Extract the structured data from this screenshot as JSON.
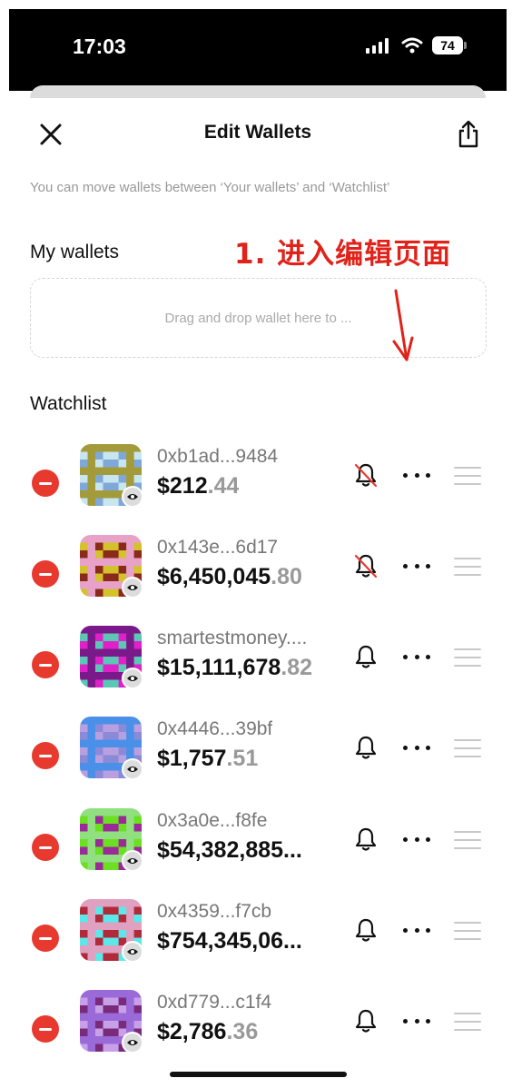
{
  "status_bar": {
    "time": "17:03",
    "battery": "74"
  },
  "header": {
    "title": "Edit Wallets"
  },
  "hint": "You can move wallets between ‘Your wallets’ and ‘Watchlist’",
  "my_wallets": {
    "title": "My wallets",
    "dropzone_text": "Drag and drop wallet here to ..."
  },
  "annotation": "1. 进入编辑页面",
  "watchlist": {
    "title": "Watchlist",
    "wallets": [
      {
        "address": "0xb1ad...9484",
        "balance_main": "$212",
        "balance_cents": ".44",
        "alerts": "off",
        "avatar_colors": [
          "#a39a3a",
          "#7fa8d8",
          "#c8e6f0"
        ]
      },
      {
        "address": "0x143e...6d17",
        "balance_main": "$6,450,045",
        "balance_cents": ".80",
        "alerts": "off",
        "avatar_colors": [
          "#d4c22a",
          "#e8a2c8",
          "#8a2a1a"
        ]
      },
      {
        "address": "smartestmoney....",
        "balance_main": "$15,111,678",
        "balance_cents": ".82",
        "alerts": "on",
        "avatar_colors": [
          "#e020c8",
          "#5ac8b4",
          "#7a1a8a"
        ]
      },
      {
        "address": "0x4446...39bf",
        "balance_main": "$1,757",
        "balance_cents": ".51",
        "alerts": "on",
        "avatar_colors": [
          "#4a90e8",
          "#8a8ad8",
          "#b8a0e0"
        ]
      },
      {
        "address": "0x3a0e...f8fe",
        "balance_main": "$54,382,885...",
        "balance_cents": "",
        "alerts": "on",
        "avatar_colors": [
          "#6ae020",
          "#90e080",
          "#9a2a9a"
        ]
      },
      {
        "address": "0x4359...f7cb",
        "balance_main": "$754,345,06...",
        "balance_cents": "",
        "alerts": "on",
        "avatar_colors": [
          "#5ae8e8",
          "#b02a3a",
          "#e0a0c0"
        ]
      },
      {
        "address": "0xd779...c1f4",
        "balance_main": "$2,786",
        "balance_cents": ".36",
        "alerts": "on",
        "avatar_colors": [
          "#9a6ad8",
          "#7a2a7a",
          "#c8a0e8"
        ]
      }
    ]
  },
  "colors": {
    "remove": "#e8392f",
    "annotation": "#e0231a"
  }
}
